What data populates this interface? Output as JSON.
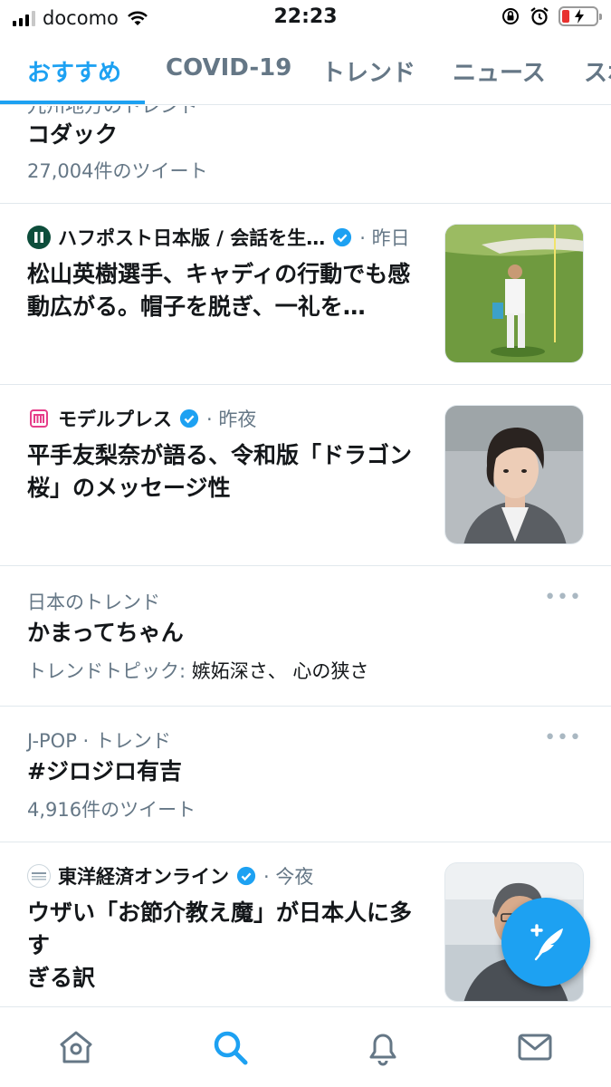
{
  "status_bar": {
    "carrier": "docomo",
    "time": "22:23"
  },
  "tabs": [
    {
      "label": "おすすめ",
      "active": true
    },
    {
      "label": "COVID-19"
    },
    {
      "label": "トレンド"
    },
    {
      "label": "ニュース"
    },
    {
      "label": "スポ"
    }
  ],
  "feed": {
    "item0": {
      "category": "九州地方のトレンド",
      "title": "コダック",
      "count": "27,004件のツイート"
    },
    "item1": {
      "source": "ハフポスト日本版 / 会話を生…",
      "time": "· 昨日",
      "title_l1": "松山英樹選手、キャディの行動でも感",
      "title_l2": "動広がる。帽子を脱ぎ、一礼を…",
      "logo": "huffpost-logo",
      "image": "golf-caddie-photo"
    },
    "item2": {
      "source": "モデルプレス",
      "time": "· 昨夜",
      "title_l1": "平手友梨奈が語る、令和版「ドラゴン",
      "title_l2": "桜」のメッセージ性",
      "logo": "modelpress-logo",
      "image": "actress-portrait-photo"
    },
    "item3": {
      "category": "日本のトレンド",
      "title": "かまってちゃん",
      "topic_prefix": "トレンドトピック: ",
      "topic_values": "嫉妬深さ、 心の狭さ"
    },
    "item4": {
      "category": "J-POP · トレンド",
      "title": "#ジロジロ有吉",
      "count": "4,916件のツイート"
    },
    "item5": {
      "source": "東洋経済オンライン",
      "time": "· 今夜",
      "title_l1": "ウザい「お節介教え魔」が日本人に多す",
      "title_l2": "ぎる訳",
      "logo": "toyokeizai-logo",
      "image": "businessman-photo"
    }
  },
  "bottom_nav": [
    "home-icon",
    "search-icon",
    "notifications-icon",
    "messages-icon"
  ],
  "colors": {
    "accent": "#1da1f2",
    "text": "#14171a",
    "secondary": "#657786",
    "divider": "#e1e8ed"
  }
}
